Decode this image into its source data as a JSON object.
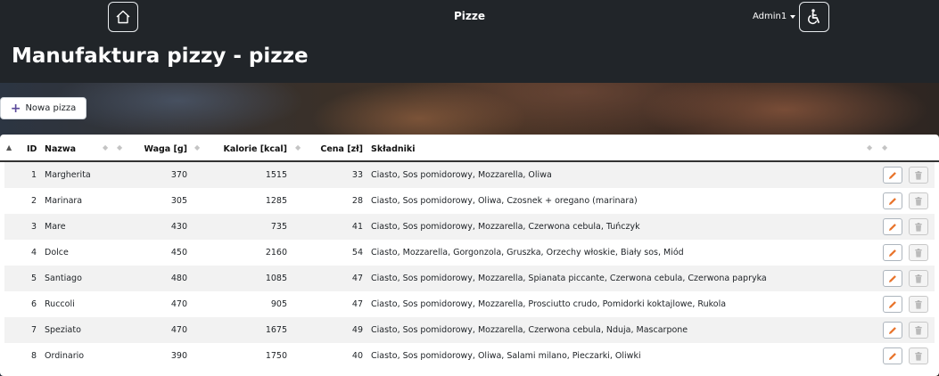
{
  "nav": {
    "title": "Pizze",
    "user": "Admin1",
    "home_icon": "home-icon",
    "accessibility_icon": "wheelchair-icon"
  },
  "page": {
    "title": "Manufaktura pizzy - pizze"
  },
  "actions": {
    "new_label": "Nowa pizza",
    "new_icon": "plus-icon"
  },
  "table": {
    "columns": {
      "id": "ID",
      "name": "Nazwa",
      "weight": "Waga [g]",
      "calories": "Kalorie [kcal]",
      "price": "Cena [zł]",
      "ingredients": "Składniki"
    },
    "sorted_column": "id",
    "rows": [
      {
        "id": "1",
        "name": "Margherita",
        "weight": "370",
        "calories": "1515",
        "price": "33",
        "ingredients": "Ciasto, Sos pomidorowy, Mozzarella, Oliwa"
      },
      {
        "id": "2",
        "name": "Marinara",
        "weight": "305",
        "calories": "1285",
        "price": "28",
        "ingredients": "Ciasto, Sos pomidorowy, Oliwa, Czosnek + oregano (marinara)"
      },
      {
        "id": "3",
        "name": "Mare",
        "weight": "430",
        "calories": "735",
        "price": "41",
        "ingredients": "Ciasto, Sos pomidorowy, Mozzarella, Czerwona cebula, Tuńczyk"
      },
      {
        "id": "4",
        "name": "Dolce",
        "weight": "450",
        "calories": "2160",
        "price": "54",
        "ingredients": "Ciasto, Mozzarella, Gorgonzola, Gruszka, Orzechy włoskie, Biały sos, Miód"
      },
      {
        "id": "5",
        "name": "Santiago",
        "weight": "480",
        "calories": "1085",
        "price": "47",
        "ingredients": "Ciasto, Sos pomidorowy, Mozzarella, Spianata piccante, Czerwona cebula, Czerwona papryka"
      },
      {
        "id": "6",
        "name": "Ruccoli",
        "weight": "470",
        "calories": "905",
        "price": "47",
        "ingredients": "Ciasto, Sos pomidorowy, Mozzarella, Prosciutto crudo, Pomidorki koktajlowe, Rukola"
      },
      {
        "id": "7",
        "name": "Speziato",
        "weight": "470",
        "calories": "1675",
        "price": "49",
        "ingredients": "Ciasto, Sos pomidorowy, Mozzarella, Czerwona cebula, Nduja, Mascarpone"
      },
      {
        "id": "8",
        "name": "Ordinario",
        "weight": "390",
        "calories": "1750",
        "price": "40",
        "ingredients": "Ciasto, Sos pomidorowy, Oliwa, Salami milano, Pieczarki, Oliwki"
      }
    ],
    "edit_icon": "pencil-icon",
    "delete_icon": "trash-icon"
  },
  "colors": {
    "navbar": "#212529",
    "edit_icon": "#e8742c",
    "plus_icon": "#5b4a9b"
  }
}
